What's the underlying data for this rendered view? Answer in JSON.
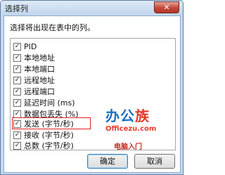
{
  "window": {
    "title": "选择列",
    "close_glyph": "✕"
  },
  "prompt": "选择将出现在表中的列。",
  "columns": [
    {
      "label": "PID",
      "checked": true
    },
    {
      "label": "本地地址",
      "checked": true
    },
    {
      "label": "本地端口",
      "checked": true
    },
    {
      "label": "远程地址",
      "checked": true
    },
    {
      "label": "远程端口",
      "checked": true
    },
    {
      "label": "延迟时间 (ms)",
      "checked": true
    },
    {
      "label": "数据包丢失 (%)",
      "checked": true
    },
    {
      "label": "发送 (字节/秒)",
      "checked": true
    },
    {
      "label": "接收 (字节/秒)",
      "checked": true
    },
    {
      "label": "总数 (字节/秒)",
      "checked": true
    }
  ],
  "check_glyph": "✓",
  "buttons": {
    "ok": "确定",
    "cancel": "取消"
  },
  "watermark": {
    "logo_a": "办公",
    "logo_b": "族",
    "url": "Officezu.com",
    "text": "电脑入门"
  },
  "colors": {
    "highlight": "#e02020",
    "title_bar": "#c2d6ec",
    "close_button": "#c4463a"
  },
  "icons": [
    "close-icon",
    "checkbox-checked-icon"
  ]
}
